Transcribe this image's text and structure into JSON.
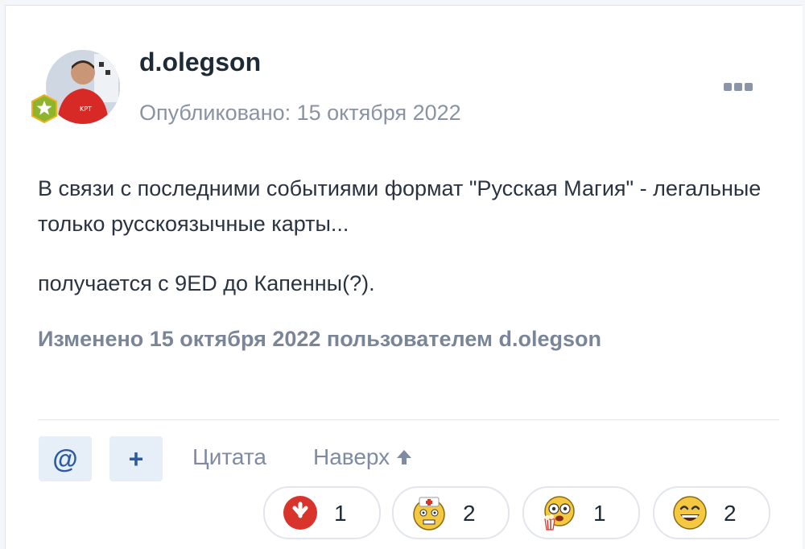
{
  "author": {
    "username": "d.olegson",
    "published": "Опубликовано: 15 октября 2022"
  },
  "post": {
    "paragraph_1": "В связи с последними событиями формат \"Русская Магия\" - легальные только русскоязычные карты...",
    "paragraph_2": "получается с 9ED до Капенны(?).",
    "edited": "Изменено 15 октября 2022 пользователем d.olegson"
  },
  "actions": {
    "mention_label": "@",
    "add_label": "+",
    "quote_label": "Цитата",
    "top_label": "Наверх"
  },
  "reactions": [
    {
      "icon": "downvote-icon",
      "count": "1"
    },
    {
      "icon": "nurse-face-icon",
      "count": "2"
    },
    {
      "icon": "popcorn-face-icon",
      "count": "1"
    },
    {
      "icon": "grinning-face-icon",
      "count": "2"
    }
  ],
  "colors": {
    "accent": "#2a5aa0",
    "muted": "#8993a3",
    "button_bg": "#e6eef7",
    "downvote": "#d9342b"
  }
}
